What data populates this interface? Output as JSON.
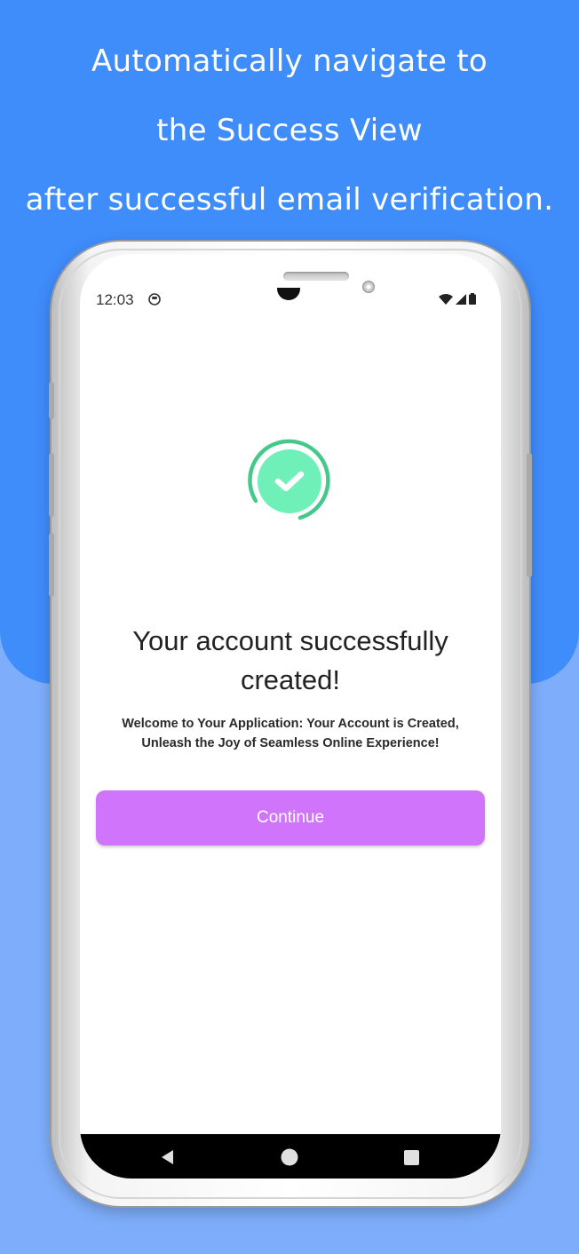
{
  "headline": {
    "line1": "Automatically navigate to",
    "line2": "the Success View",
    "line3": "after successful email verification."
  },
  "status_bar": {
    "time": "12:03",
    "app_icon": "android-notification-icon",
    "icons": [
      "wifi-icon",
      "signal-icon",
      "battery-icon"
    ]
  },
  "success": {
    "icon": "check-circle-icon",
    "title_line1": "Your account successfully",
    "title_line2": "created!",
    "subtitle_line1": "Welcome to Your Application: Your Account is Created,",
    "subtitle_line2": "Unleash the Joy of Seamless Online Experience!",
    "continue_label": "Continue"
  },
  "nav_bar": {
    "buttons": [
      "back-icon",
      "home-icon",
      "recents-icon"
    ]
  },
  "colors": {
    "background_top": "#3f8cfb",
    "background_bottom": "#7eaefb",
    "button": "#d074fb",
    "check_fill": "#6ff0b8",
    "check_ring": "#45c98a"
  }
}
